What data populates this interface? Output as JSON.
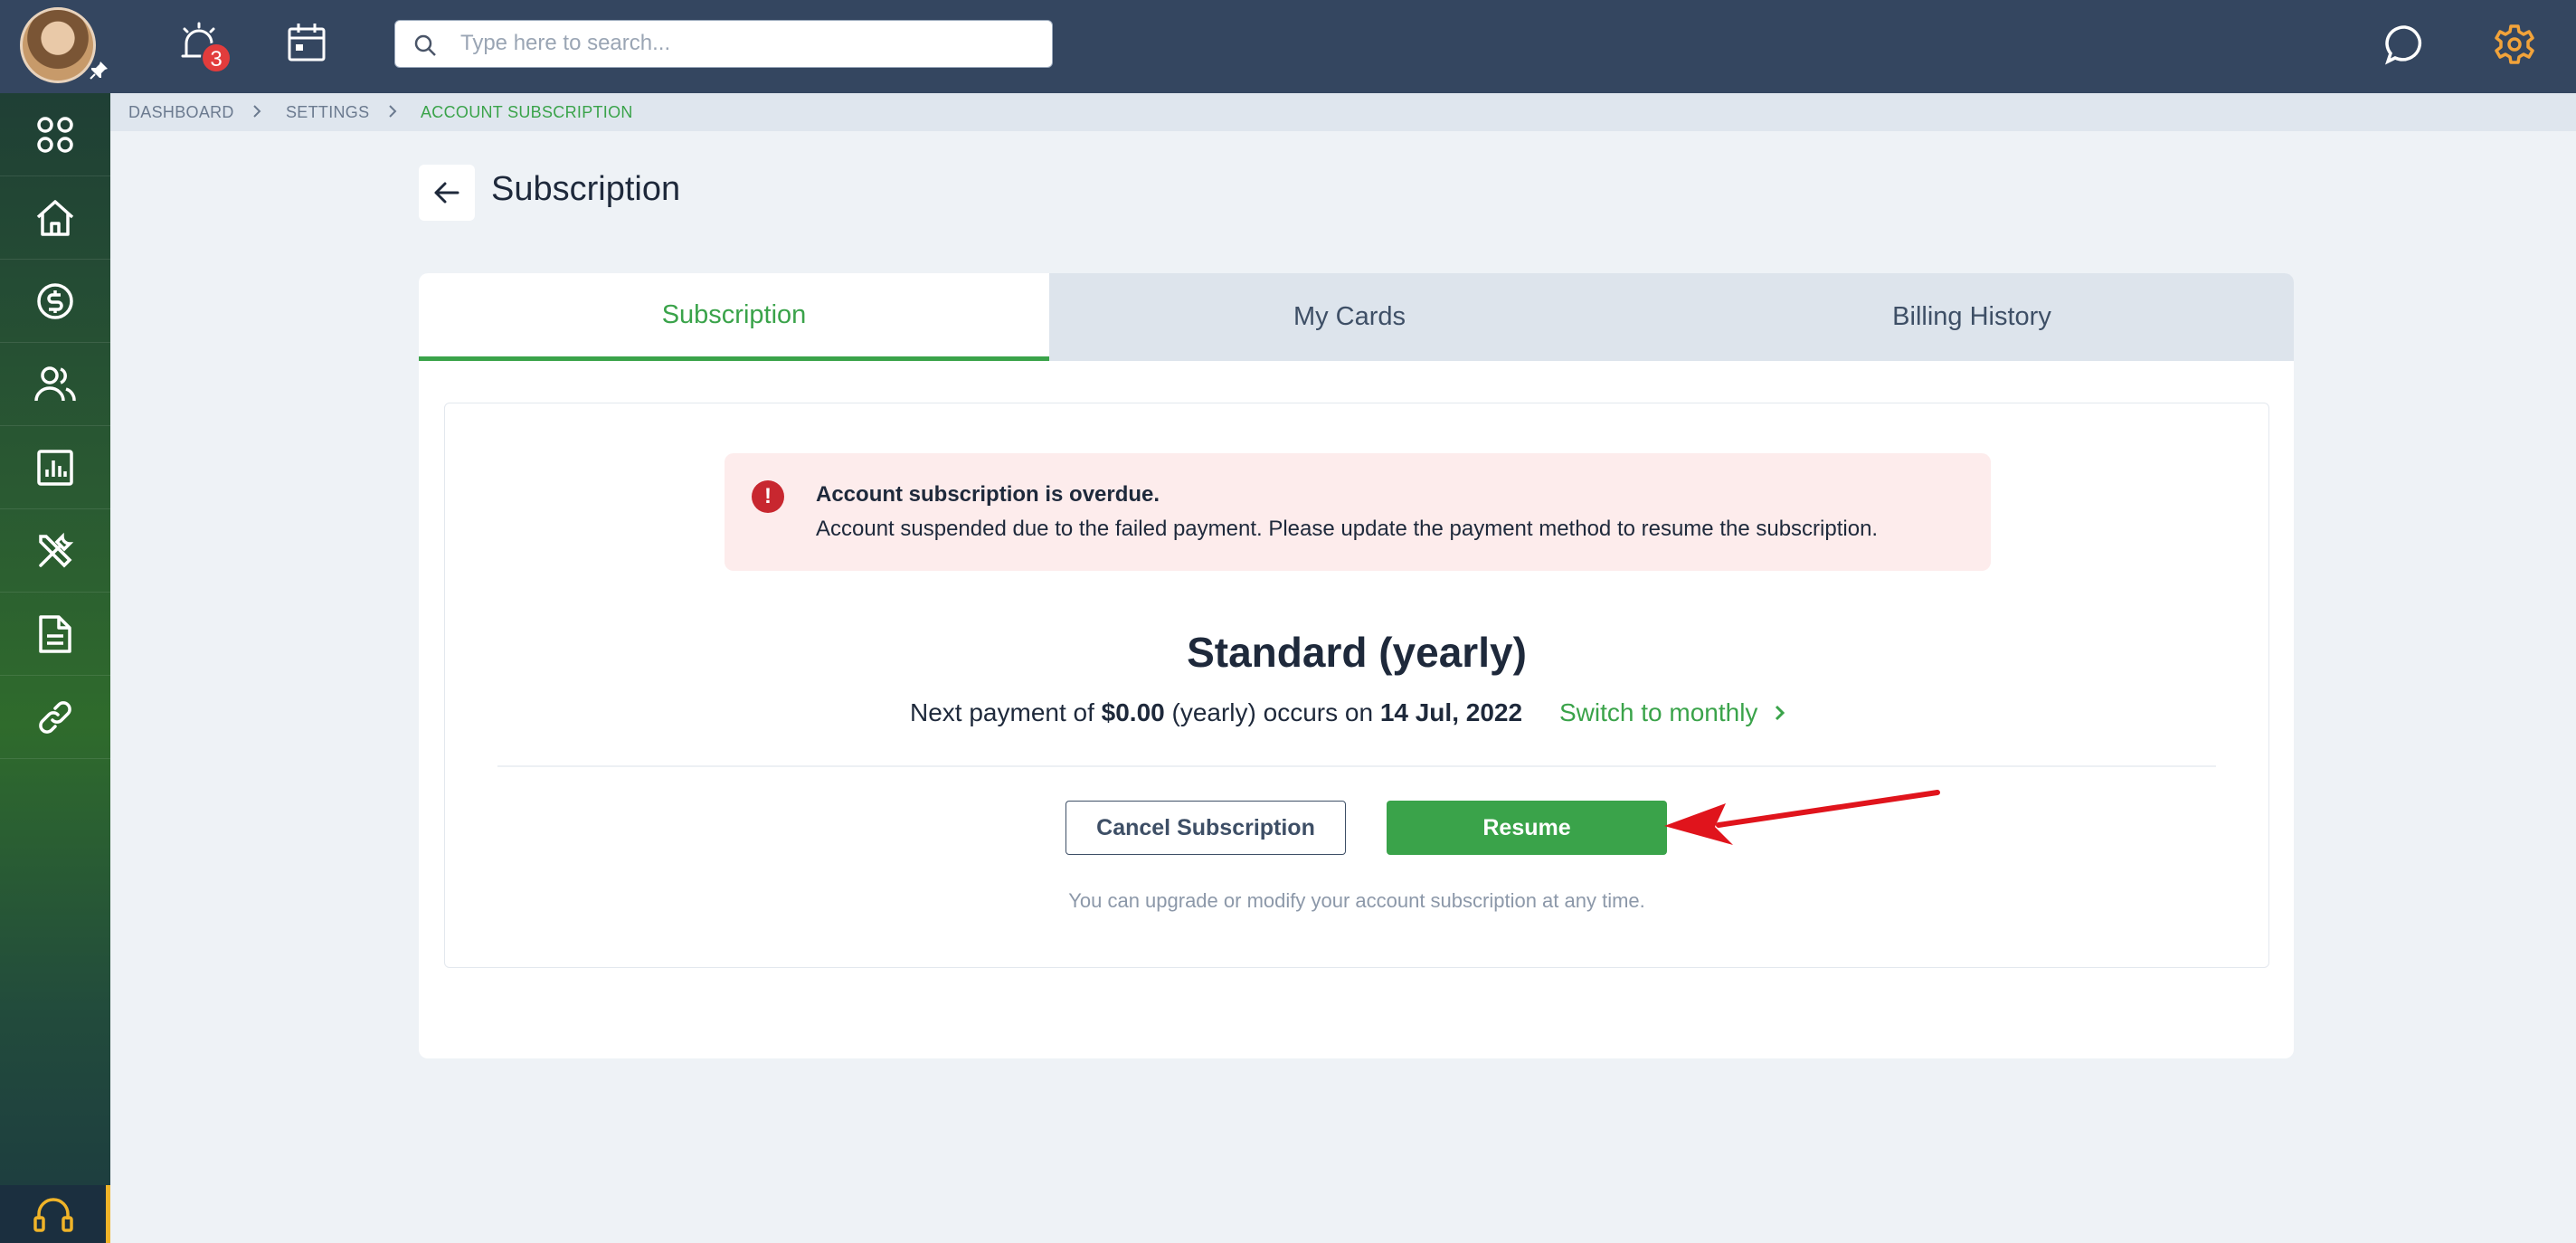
{
  "topbar": {
    "alerts_count": "3",
    "search_placeholder": "Type here to search...",
    "icons": [
      "alarm-icon",
      "calendar-icon",
      "chat-icon",
      "gear-icon"
    ]
  },
  "sidebar": {
    "items": [
      "apps-icon",
      "home-icon",
      "dollar-icon",
      "users-icon",
      "chart-icon",
      "tools-icon",
      "document-icon",
      "link-icon"
    ],
    "bottom": "headset-icon"
  },
  "breadcrumb": [
    "DASHBOARD",
    "SETTINGS",
    "ACCOUNT SUBSCRIPTION"
  ],
  "page": {
    "title": "Subscription"
  },
  "tabs": [
    {
      "label": "Subscription",
      "active": true
    },
    {
      "label": "My Cards",
      "active": false
    },
    {
      "label": "Billing History",
      "active": false
    }
  ],
  "alert": {
    "title": "Account subscription is overdue.",
    "text": "Account suspended due to the failed payment. Please update the payment method to resume the subscription."
  },
  "plan": {
    "name": "Standard (yearly)",
    "payment_prefix": "Next payment of",
    "amount": "$0.00",
    "period": "(yearly) occurs on",
    "date": "14 Jul, 2022",
    "switch_label": "Switch to monthly"
  },
  "actions": {
    "cancel_label": "Cancel Subscription",
    "resume_label": "Resume",
    "hint": "You can upgrade or modify your account subscription at any time."
  },
  "colors": {
    "topbar": "#344660",
    "accent_green": "#3aa34a",
    "alert_bg": "#fdecec",
    "alert_icon": "#c8272f",
    "annotation_arrow": "#e0141c"
  }
}
